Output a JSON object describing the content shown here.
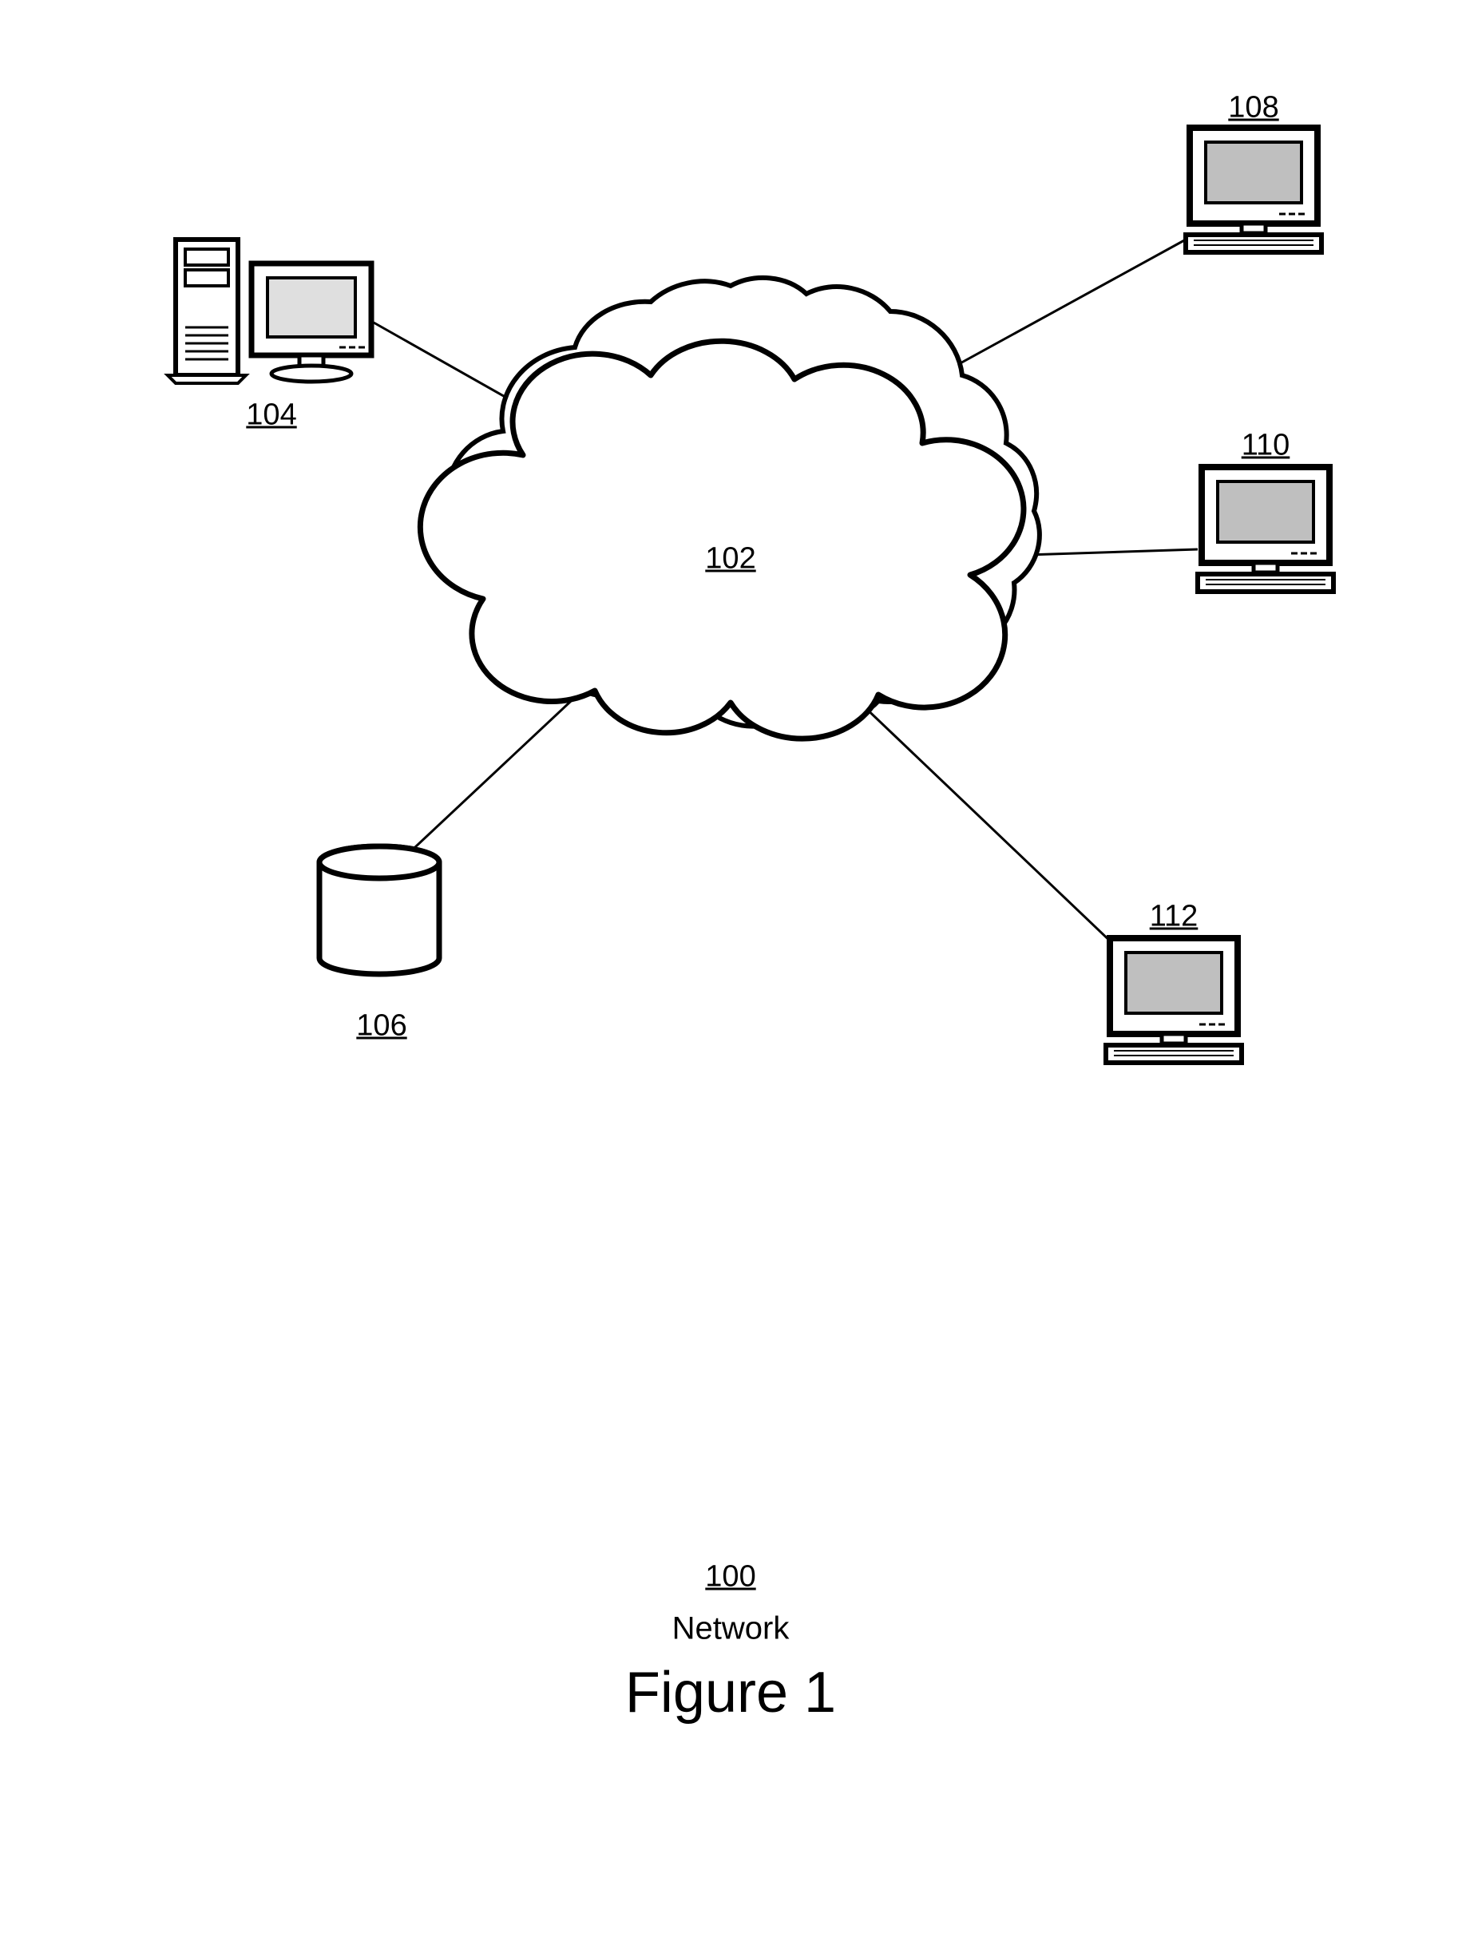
{
  "diagram": {
    "cloud_label": "102",
    "server_label": "104",
    "database_label": "106",
    "client_tr_label": "108",
    "client_r_label": "110",
    "client_br_label": "112",
    "footer_number": "100",
    "footer_caption": "Network",
    "figure_title": "Figure 1"
  }
}
